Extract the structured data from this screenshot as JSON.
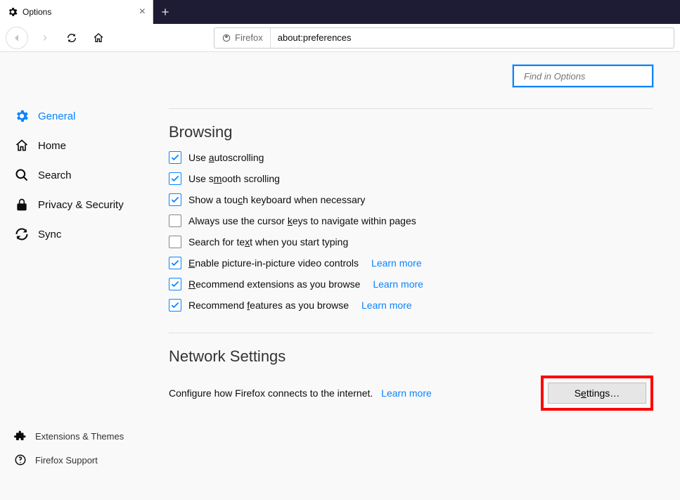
{
  "tab": {
    "title": "Options"
  },
  "url": {
    "identity": "Firefox",
    "address": "about:preferences"
  },
  "search": {
    "placeholder": "Find in Options"
  },
  "sidebar": {
    "items": [
      {
        "label": "General",
        "active": true
      },
      {
        "label": "Home",
        "active": false
      },
      {
        "label": "Search",
        "active": false
      },
      {
        "label": "Privacy & Security",
        "active": false
      },
      {
        "label": "Sync",
        "active": false
      }
    ],
    "footer": [
      {
        "label": "Extensions & Themes"
      },
      {
        "label": "Firefox Support"
      }
    ]
  },
  "browsing": {
    "title": "Browsing",
    "items": [
      {
        "checked": true,
        "pre": "Use ",
        "ak": "a",
        "post": "utoscrolling",
        "learn": false
      },
      {
        "checked": true,
        "pre": "Use s",
        "ak": "m",
        "post": "ooth scrolling",
        "learn": false
      },
      {
        "checked": true,
        "pre": "Show a tou",
        "ak": "c",
        "post": "h keyboard when necessary",
        "learn": false
      },
      {
        "checked": false,
        "pre": "Always use the cursor ",
        "ak": "k",
        "post": "eys to navigate within pages",
        "learn": false
      },
      {
        "checked": false,
        "pre": "Search for te",
        "ak": "x",
        "post": "t when you start typing",
        "learn": false
      },
      {
        "checked": true,
        "pre": "",
        "ak": "E",
        "post": "nable picture-in-picture video controls",
        "learn": true
      },
      {
        "checked": true,
        "pre": "",
        "ak": "R",
        "post": "ecommend extensions as you browse",
        "learn": true
      },
      {
        "checked": true,
        "pre": "Recommend ",
        "ak": "f",
        "post": "eatures as you browse",
        "learn": true
      }
    ],
    "learn_more": "Learn more"
  },
  "network": {
    "title": "Network Settings",
    "desc": "Configure how Firefox connects to the internet.",
    "learn_more": "Learn more",
    "button_pre": "S",
    "button_ak": "e",
    "button_post": "ttings…"
  }
}
